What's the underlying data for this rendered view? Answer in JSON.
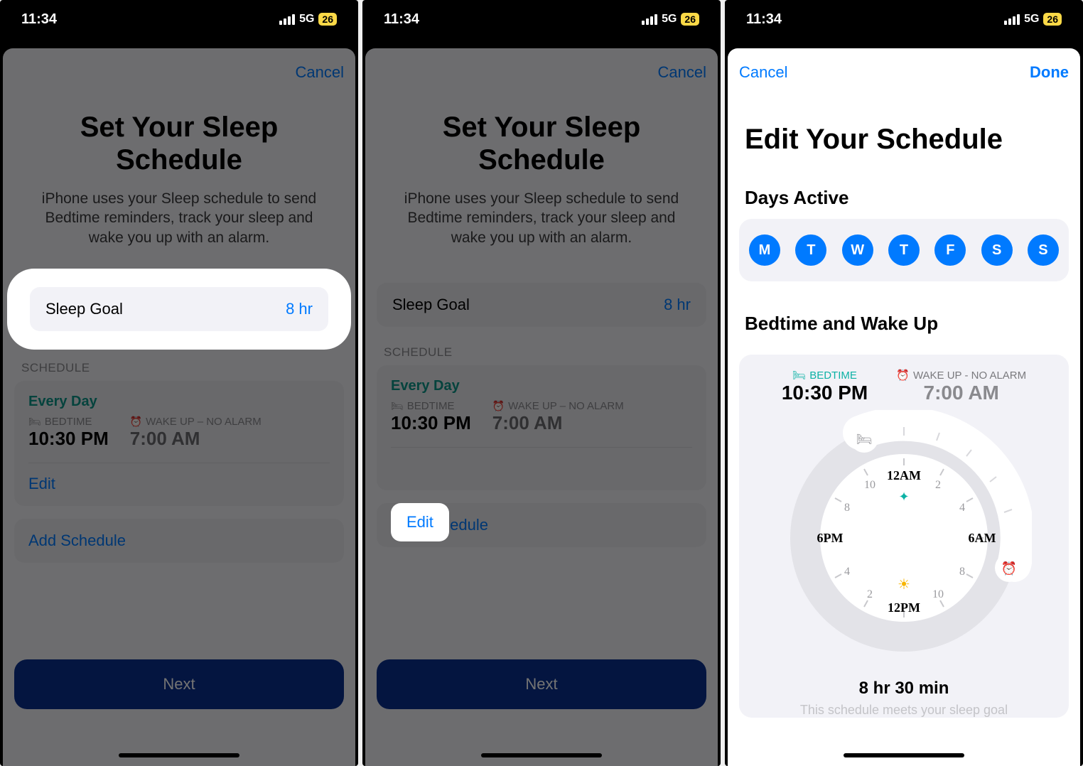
{
  "status": {
    "time": "11:34",
    "network": "5G",
    "battery": "26"
  },
  "screen1": {
    "cancel": "Cancel",
    "title": "Set Your Sleep Schedule",
    "subtitle": "iPhone uses your Sleep schedule to send Bedtime reminders, track your sleep and wake you up with an alarm.",
    "sleep_goal_label": "Sleep Goal",
    "sleep_goal_value": "8 hr",
    "schedule_label": "SCHEDULE",
    "every_day": "Every Day",
    "bedtime_label": "BEDTIME",
    "bedtime": "10:30 PM",
    "wake_label": "WAKE UP – NO ALARM",
    "wake": "7:00 AM",
    "edit": "Edit",
    "add_schedule": "Add Schedule",
    "next": "Next"
  },
  "screen2": {
    "cancel": "Cancel",
    "title": "Set Your Sleep Schedule",
    "subtitle": "iPhone uses your Sleep schedule to send Bedtime reminders, track your sleep and wake you up with an alarm.",
    "sleep_goal_label": "Sleep Goal",
    "sleep_goal_value": "8 hr",
    "schedule_label": "SCHEDULE",
    "every_day": "Every Day",
    "bedtime_label": "BEDTIME",
    "bedtime": "10:30 PM",
    "wake_label": "WAKE UP – NO ALARM",
    "wake": "7:00 AM",
    "edit": "Edit",
    "add_schedule": "Add Schedule",
    "next": "Next"
  },
  "screen3": {
    "cancel": "Cancel",
    "done": "Done",
    "title": "Edit Your Schedule",
    "days_active_label": "Days Active",
    "days": [
      "M",
      "T",
      "W",
      "T",
      "F",
      "S",
      "S"
    ],
    "bw_label": "Bedtime and Wake Up",
    "bedtime_label": "BEDTIME",
    "bedtime": "10:30 PM",
    "wake_label": "WAKE UP - NO ALARM",
    "wake": "7:00 AM",
    "clock_hours": {
      "t12am": "12AM",
      "t2": "2",
      "t4": "4",
      "t6am": "6AM",
      "t8": "8",
      "t10": "10",
      "t12pm": "12PM",
      "t10b": "10",
      "t8b": "8",
      "t6pm": "6PM",
      "t4b": "4",
      "t2b": "2"
    },
    "duration": "8 hr 30 min",
    "hint": "This schedule meets your sleep goal"
  }
}
